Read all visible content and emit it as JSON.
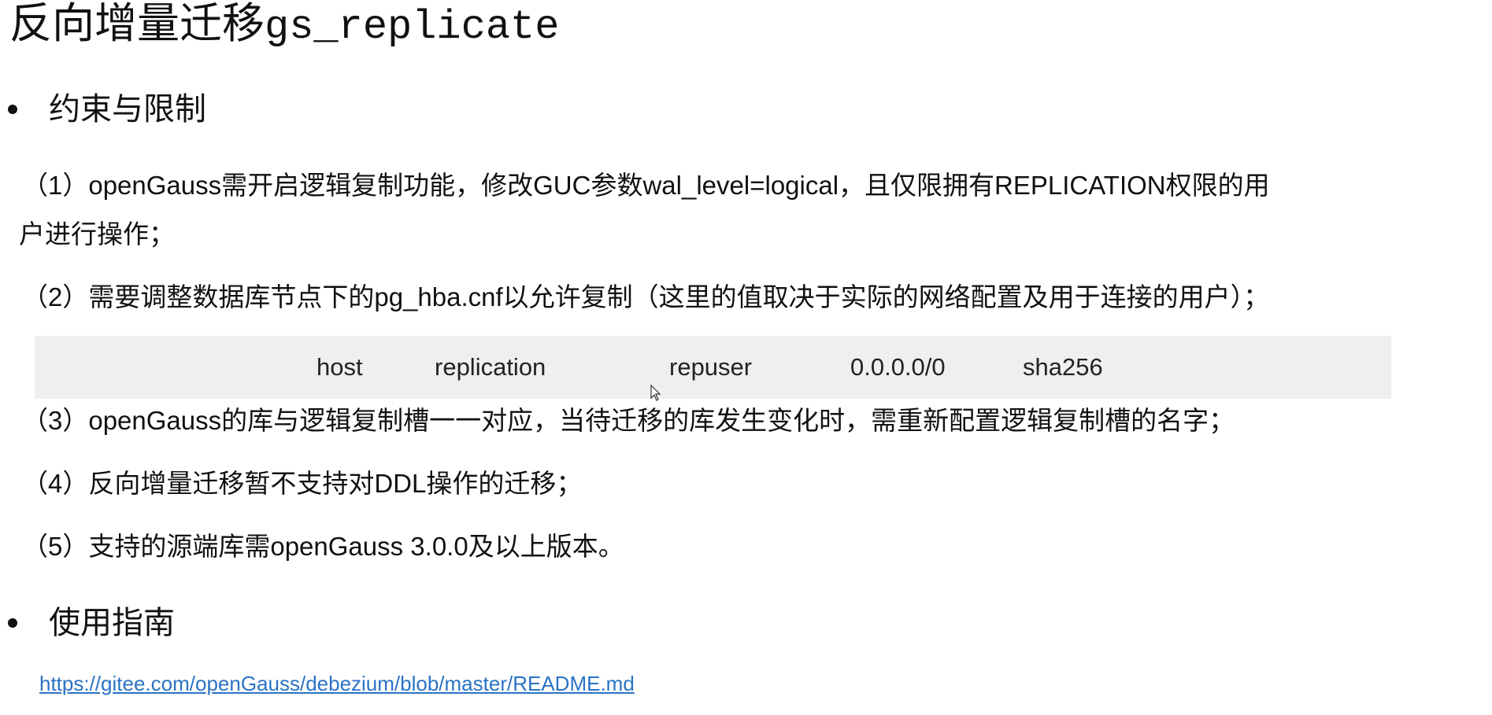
{
  "slide": {
    "title_cjk": "反向增量迁移",
    "title_code": "gs_replicate"
  },
  "sections": [
    {
      "label": "约束与限制"
    },
    {
      "label": "使用指南"
    }
  ],
  "items": {
    "item1_line1": "（1）openGauss需开启逻辑复制功能，修改GUC参数wal_level=logical，且仅限拥有REPLICATION权限的用",
    "item1_line2": "户进行操作；",
    "item2": "（2）需要调整数据库节点下的pg_hba.cnf以允许复制（这里的值取决于实际的网络配置及用于连接的用户）；",
    "item3": "（3）openGauss的库与逻辑复制槽一一对应，当待迁移的库发生变化时，需重新配置逻辑复制槽的名字；",
    "item4": "（4）反向增量迁移暂不支持对DDL操作的迁移；",
    "item5": "（5）支持的源端库需openGauss 3.0.0及以上版本。"
  },
  "hba_entry": {
    "type": "host",
    "database": "replication",
    "user": "repuser",
    "address": "0.0.0.0/0",
    "method": "sha256",
    "background_color": "#efefef"
  },
  "guide": {
    "link_text": "https://gitee.com/openGauss/debezium/blob/master/README.md",
    "link_color": "#2a73c5"
  }
}
